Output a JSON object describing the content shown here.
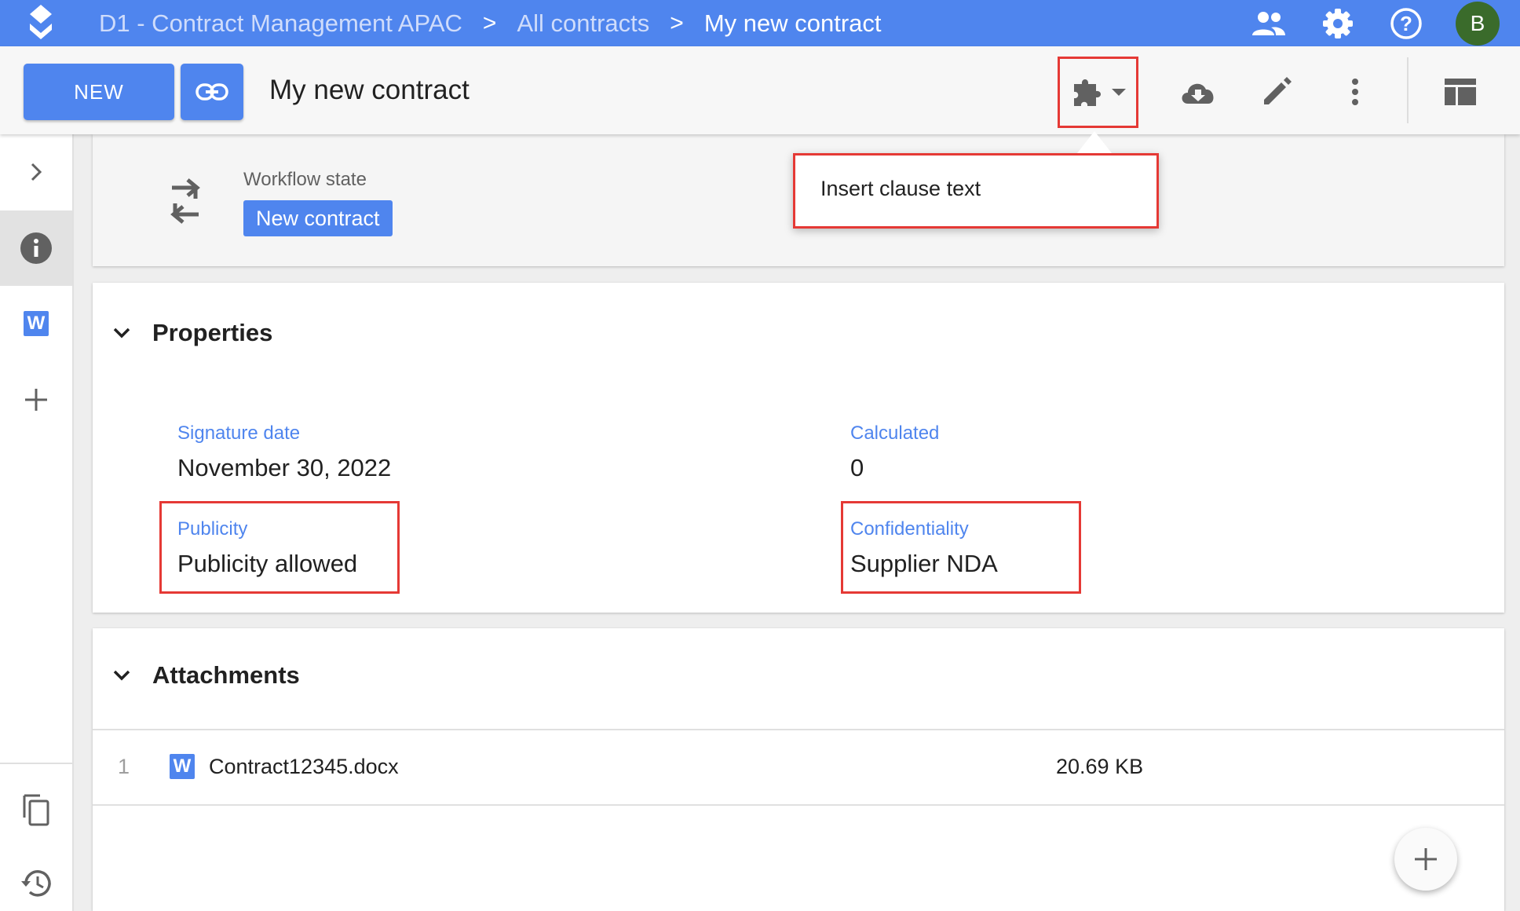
{
  "appbar": {
    "breadcrumbs": [
      "D1 - Contract Management APAC",
      "All contracts",
      "My new contract"
    ],
    "separator": ">",
    "avatar_initial": "B",
    "icons": [
      "people-icon",
      "gear-icon",
      "help-icon"
    ]
  },
  "toolbar": {
    "new_label": "NEW",
    "title": "My new contract",
    "icons": [
      "link-icon",
      "puzzle-icon",
      "cloud-download-icon",
      "pencil-icon",
      "more-vert-icon",
      "layout-icon"
    ]
  },
  "extension_menu": {
    "items": [
      {
        "label": "Insert clause text"
      }
    ]
  },
  "rail": {
    "items": [
      "chevron-right-icon",
      "info-icon",
      "word-icon",
      "plus-icon",
      "copy-icon",
      "history-icon"
    ],
    "word_letter": "W"
  },
  "workflow": {
    "label": "Workflow state",
    "state": "New contract"
  },
  "properties": {
    "title": "Properties",
    "fields": [
      {
        "label": "Signature date",
        "value": "November 30, 2022"
      },
      {
        "label": "Calculated",
        "value": "0"
      },
      {
        "label": "Publicity",
        "value": "Publicity allowed"
      },
      {
        "label": "Confidentiality",
        "value": "Supplier NDA"
      }
    ]
  },
  "attachments": {
    "title": "Attachments",
    "rows": [
      {
        "index": "1",
        "icon_letter": "W",
        "name": "Contract12345.docx",
        "size": "20.69 KB"
      }
    ]
  },
  "colors": {
    "brand": "#4f85ee",
    "highlight": "#e53935",
    "avatar": "#3a6b2b"
  }
}
